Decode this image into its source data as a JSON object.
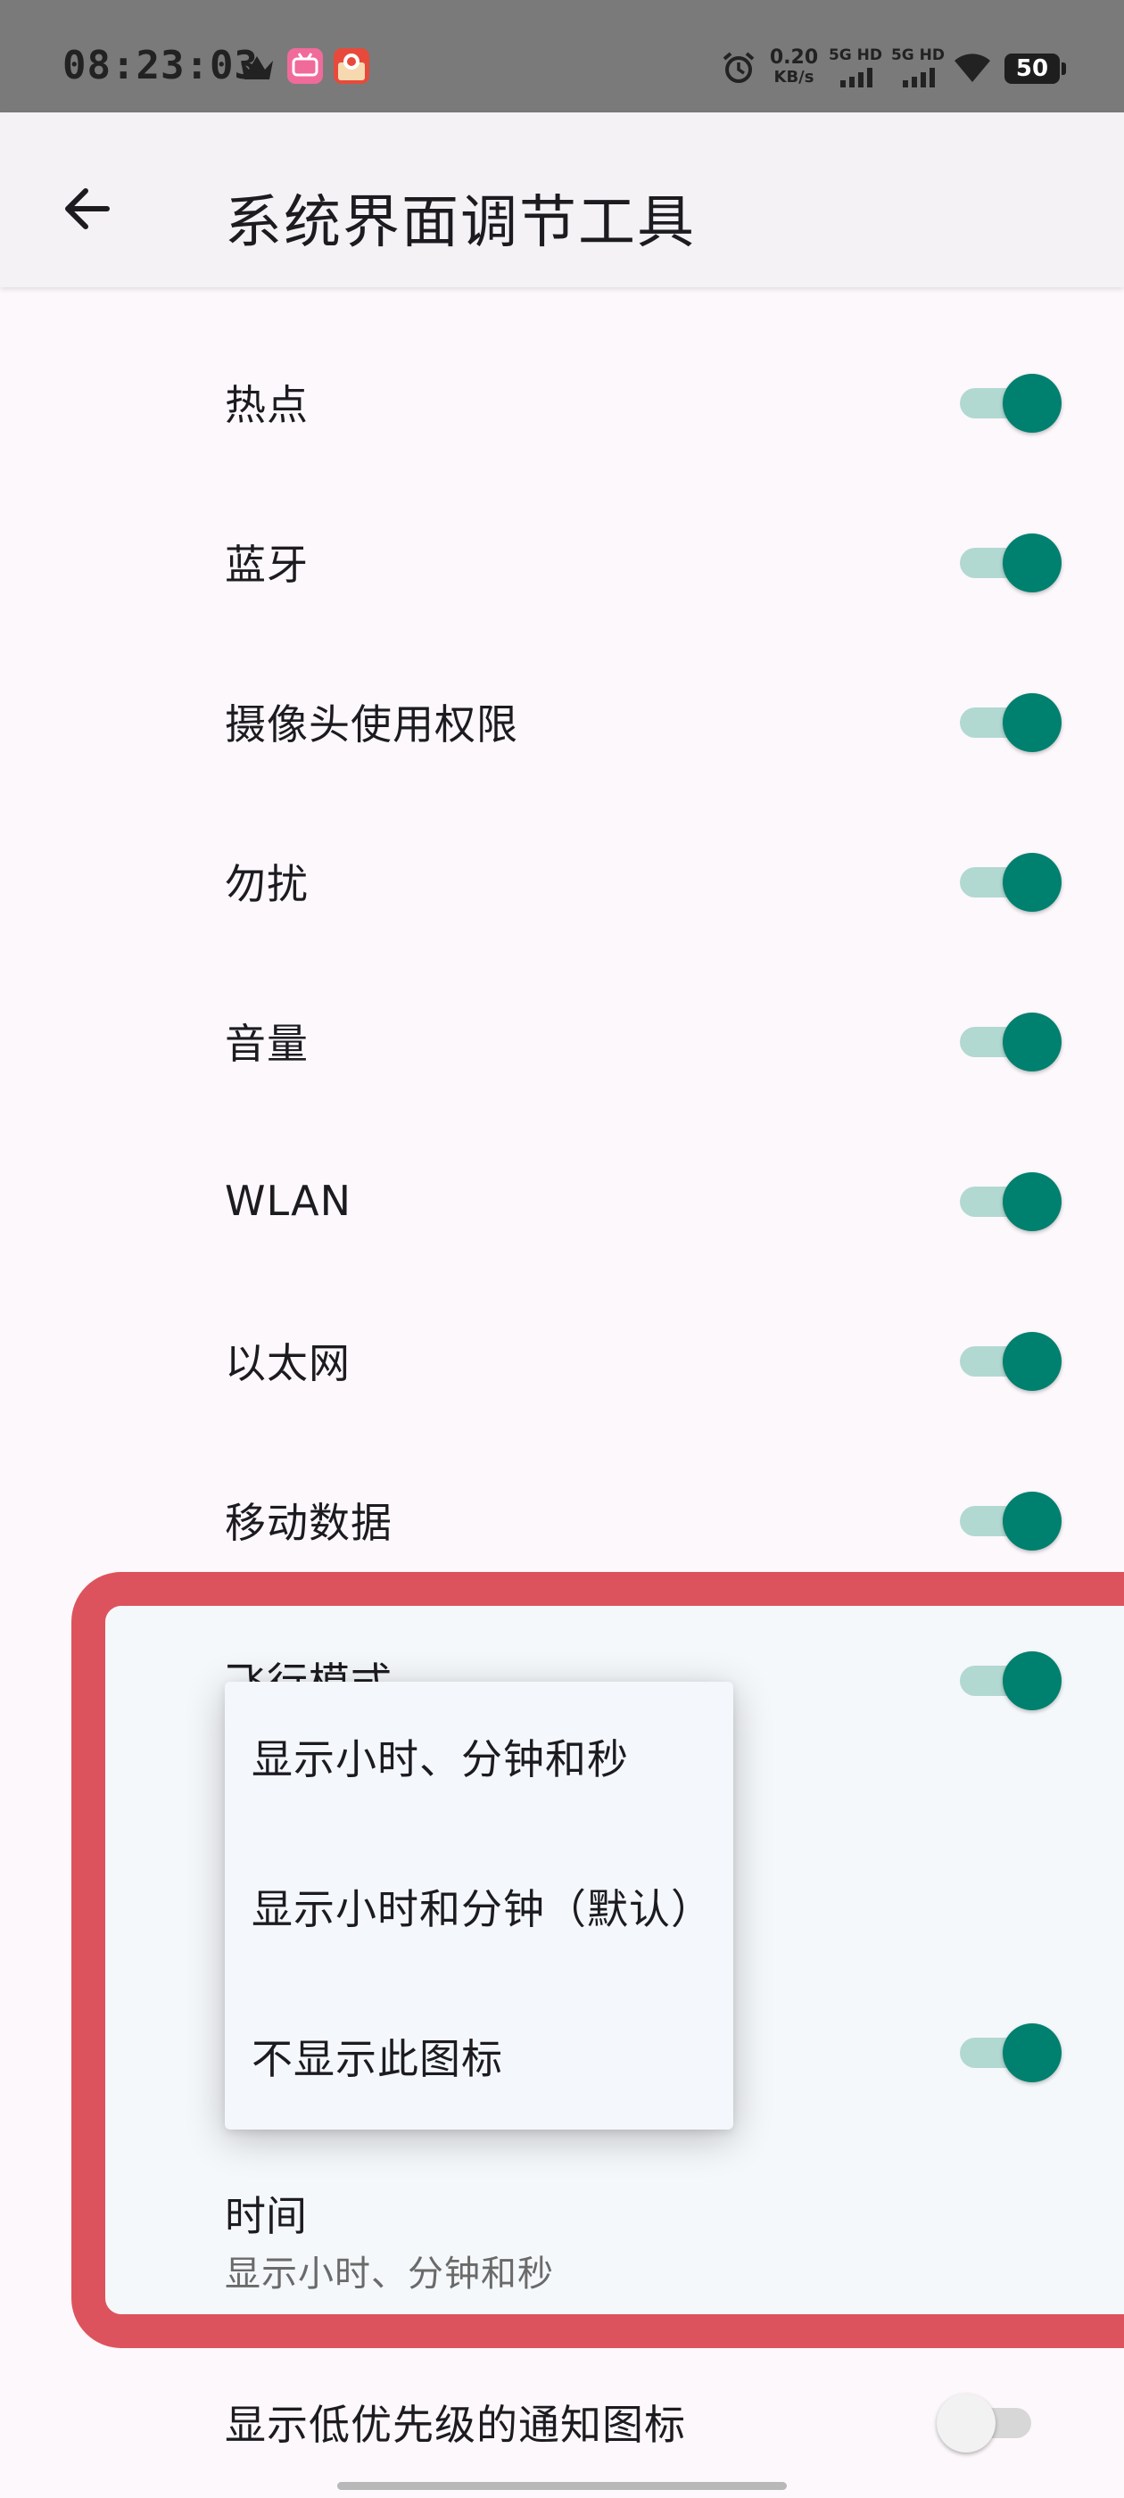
{
  "status_bar": {
    "time": "08:23:03",
    "net_speed_value": "0.20",
    "net_speed_unit": "KB/s",
    "signal1_label": "5G HD",
    "signal2_label": "5G HD",
    "battery_level": "50",
    "icons": [
      "crown-icon",
      "bilibili-app-icon",
      "red-app-icon",
      "alarm-icon",
      "wifi-icon",
      "battery-icon"
    ]
  },
  "app_bar": {
    "title": "系统界面调节工具",
    "back_icon": "back-arrow-icon"
  },
  "items": [
    {
      "label": "热点",
      "checked": true
    },
    {
      "label": "蓝牙",
      "checked": true
    },
    {
      "label": "摄像头使用权限",
      "checked": true
    },
    {
      "label": "勿扰",
      "checked": true
    },
    {
      "label": "音量",
      "checked": true
    },
    {
      "label": "WLAN",
      "checked": true
    },
    {
      "label": "以太网",
      "checked": true
    },
    {
      "label": "移动数据",
      "checked": true
    }
  ],
  "partially_hidden_item": {
    "label": "飞行模式",
    "checked": true
  },
  "hidden_row_switch": {
    "checked": true
  },
  "popup_menu": {
    "options": [
      "显示小时、分钟和秒",
      "显示小时和分钟（默认）",
      "不显示此图标"
    ]
  },
  "time_pref": {
    "title": "时间",
    "summary": "显示小时、分钟和秒"
  },
  "low_priority": {
    "label": "显示低优先级的通知图标",
    "checked": false
  },
  "colors": {
    "accent": "#00806f",
    "accent_track": "#b2d8d2",
    "highlight": "#dd535d",
    "status_bar": "#7a7a7a"
  }
}
